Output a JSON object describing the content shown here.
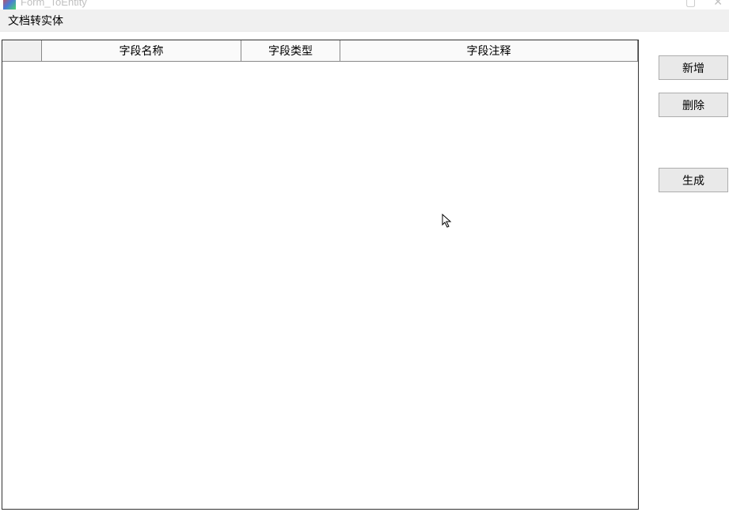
{
  "window": {
    "title": "Form_ToEntity"
  },
  "menu": {
    "doc_to_entity": "文档转实体"
  },
  "grid": {
    "columns": {
      "field_name": "字段名称",
      "field_type": "字段类型",
      "field_comment": "字段注释"
    }
  },
  "buttons": {
    "add": "新增",
    "delete": "删除",
    "generate": "生成"
  }
}
